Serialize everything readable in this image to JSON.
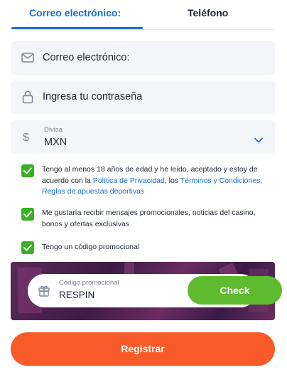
{
  "tabs": {
    "email_label": "Correo electrónico:",
    "phone_label": "Teléfono"
  },
  "email_field": {
    "placeholder": "Correo electrónico:"
  },
  "password_field": {
    "placeholder": "Ingresa tu contraseña"
  },
  "currency": {
    "label": "Divisa",
    "symbol": "$",
    "value": "MXN"
  },
  "checkboxes": {
    "terms": {
      "text_1": "Tengo al menos 18 años de edad y he leído, aceptado y estoy de acuerdo con la ",
      "link_privacy": "Política de Privacidad",
      "text_2": ", los ",
      "link_terms": "Términos y Condiciones",
      "text_3": ", ",
      "link_rules": "Reglas de apuestas deportivas"
    },
    "promotions": {
      "text": "Me gustaría recibir mensajes promocionales, noticias del casino, bonos y ofertas exclusivas"
    },
    "promo_code": {
      "text": "Tengo un código promocional"
    }
  },
  "promo": {
    "label": "Código promocional",
    "value": "RESPIN",
    "check_label": "Check"
  },
  "register_label": "Registrar",
  "colors": {
    "accent_blue": "#1a6fd1",
    "check_green": "#37b024",
    "button_green": "#5eba2f",
    "register_orange": "#f95a29"
  }
}
